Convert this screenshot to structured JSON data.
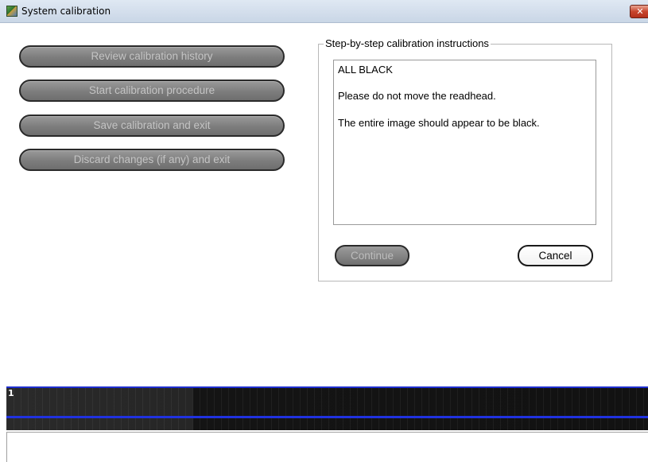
{
  "window": {
    "title": "System calibration",
    "close_label": "✕",
    "app_icon": "calibration-app-icon"
  },
  "actions": [
    {
      "label": "Review calibration history"
    },
    {
      "label": "Start calibration procedure"
    },
    {
      "label": "Save calibration and exit"
    },
    {
      "label": "Discard changes (if any) and exit"
    }
  ],
  "instructions_group": {
    "legend": "Step-by-step calibration instructions",
    "lines": [
      "ALL BLACK",
      "Please do not move the readhead.",
      "The entire image should appear to be black."
    ],
    "continue_label": "Continue",
    "cancel_label": "Cancel"
  },
  "image_strip": {
    "frame_number": "1"
  },
  "status_box": {
    "text": ""
  }
}
